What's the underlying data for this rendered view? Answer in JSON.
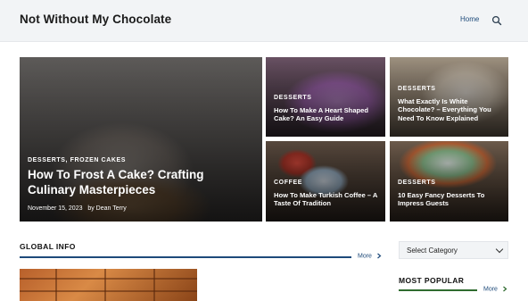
{
  "header": {
    "site_title": "Not Without My Chocolate",
    "nav_home": "Home",
    "search_icon": "search-icon"
  },
  "featured": {
    "category": "DESSERTS, FROZEN CAKES",
    "title": "How To Frost A Cake? Crafting Culinary Masterpieces",
    "date": "November 15, 2023",
    "author": "by Dean Terry"
  },
  "side_posts": [
    {
      "category": "DESSERTS",
      "title": "How To Make A Heart Shaped Cake? An Easy Guide"
    },
    {
      "category": "DESSERTS",
      "title": "What Exactly Is White Chocolate? – Everything You Need To Know Explained"
    },
    {
      "category": "COFFEE",
      "title": "How To Make Turkish Coffee – A Taste Of Tradition"
    },
    {
      "category": "DESSERTS",
      "title": "10 Easy Fancy Desserts To Impress Guests"
    }
  ],
  "global_info": {
    "title": "GLOBAL INFO",
    "more": "More",
    "accent": "#1e4a7a"
  },
  "sidebar": {
    "select_category": "Select Category",
    "most_popular": {
      "title": "MOST POPULAR",
      "more": "More",
      "accent": "#2f6b2f"
    }
  }
}
